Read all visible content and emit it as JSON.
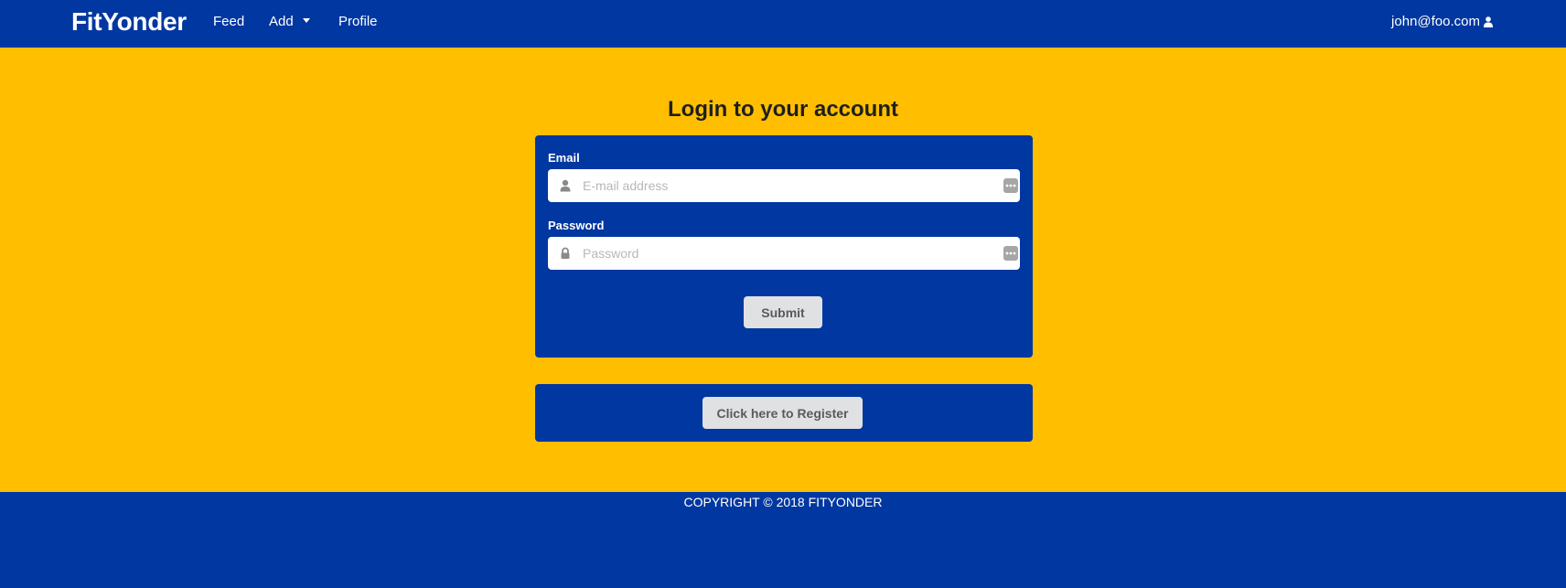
{
  "nav": {
    "brand": "FitYonder",
    "items": [
      {
        "label": "Feed"
      },
      {
        "label": "Add"
      },
      {
        "label": "Profile"
      }
    ],
    "user_email": "john@foo.com"
  },
  "login": {
    "title": "Login to your account",
    "email_label": "Email",
    "email_placeholder": "E-mail address",
    "password_label": "Password",
    "password_placeholder": "Password",
    "submit_label": "Submit"
  },
  "register": {
    "button_label": "Click here to Register"
  },
  "footer": {
    "copyright": "COPYRIGHT © 2018 FITYONDER"
  },
  "colors": {
    "primary": "#0037a0",
    "accent": "#ffbf00",
    "button": "#e0e1e2"
  },
  "icons": {
    "email_field": "user-icon",
    "password_field": "lock-icon",
    "nav_user": "user-icon",
    "add_dropdown": "caret-down-icon"
  }
}
